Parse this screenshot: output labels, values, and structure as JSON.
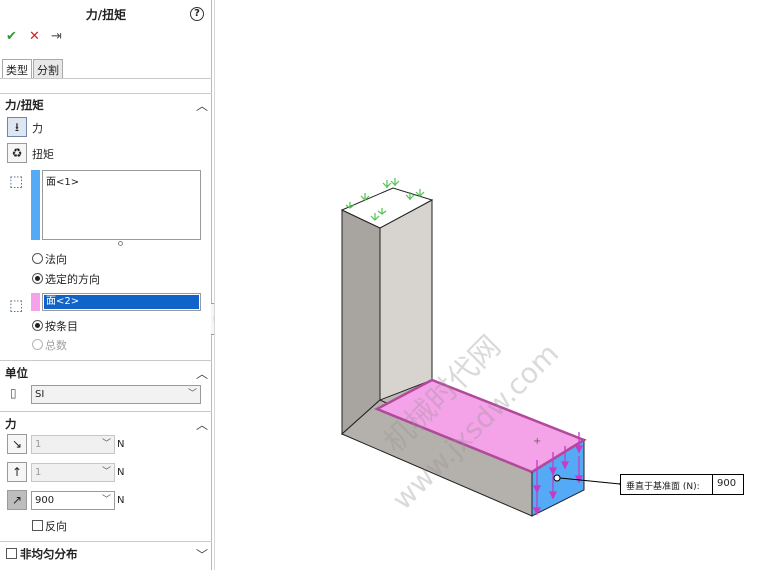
{
  "panel": {
    "title": "力/扭矩",
    "help": "?",
    "ok_icon": "check-icon",
    "cancel_icon": "close-icon",
    "pin_icon": "pushpin-icon",
    "tabs": [
      {
        "label": "类型"
      },
      {
        "label": "分割"
      }
    ]
  },
  "force_torque_section": {
    "title": "力/扭矩",
    "force_label": "力",
    "torque_label": "扭矩",
    "face_list_item": "面<1>",
    "direction_options": [
      "法向",
      "选定的方向"
    ],
    "direction_item": "面<2>",
    "distribution_options": [
      "按条目",
      "总数"
    ]
  },
  "units_section": {
    "title": "单位",
    "system_value": "SI"
  },
  "force_section": {
    "title": "力",
    "fields": [
      {
        "value": "1",
        "unit": "N",
        "enabled": false
      },
      {
        "value": "1",
        "unit": "N",
        "enabled": false
      },
      {
        "value": "900",
        "unit": "N",
        "enabled": true
      }
    ],
    "reverse_label": "反向"
  },
  "nonuniform_section": {
    "title": "非均匀分布"
  },
  "viewport": {
    "callout_label": "垂直于基准面 (N):",
    "callout_value": "900",
    "watermark_line1": "机械时代网",
    "watermark_line2": "www.jxsdw.com",
    "colors": {
      "selection_blue": "#55aaf6",
      "selection_pink": "#f5a3e8",
      "arrow_green": "#4ec44e",
      "arrow_magenta": "#c73ac7",
      "body_gray": "#b4b0ab"
    }
  }
}
